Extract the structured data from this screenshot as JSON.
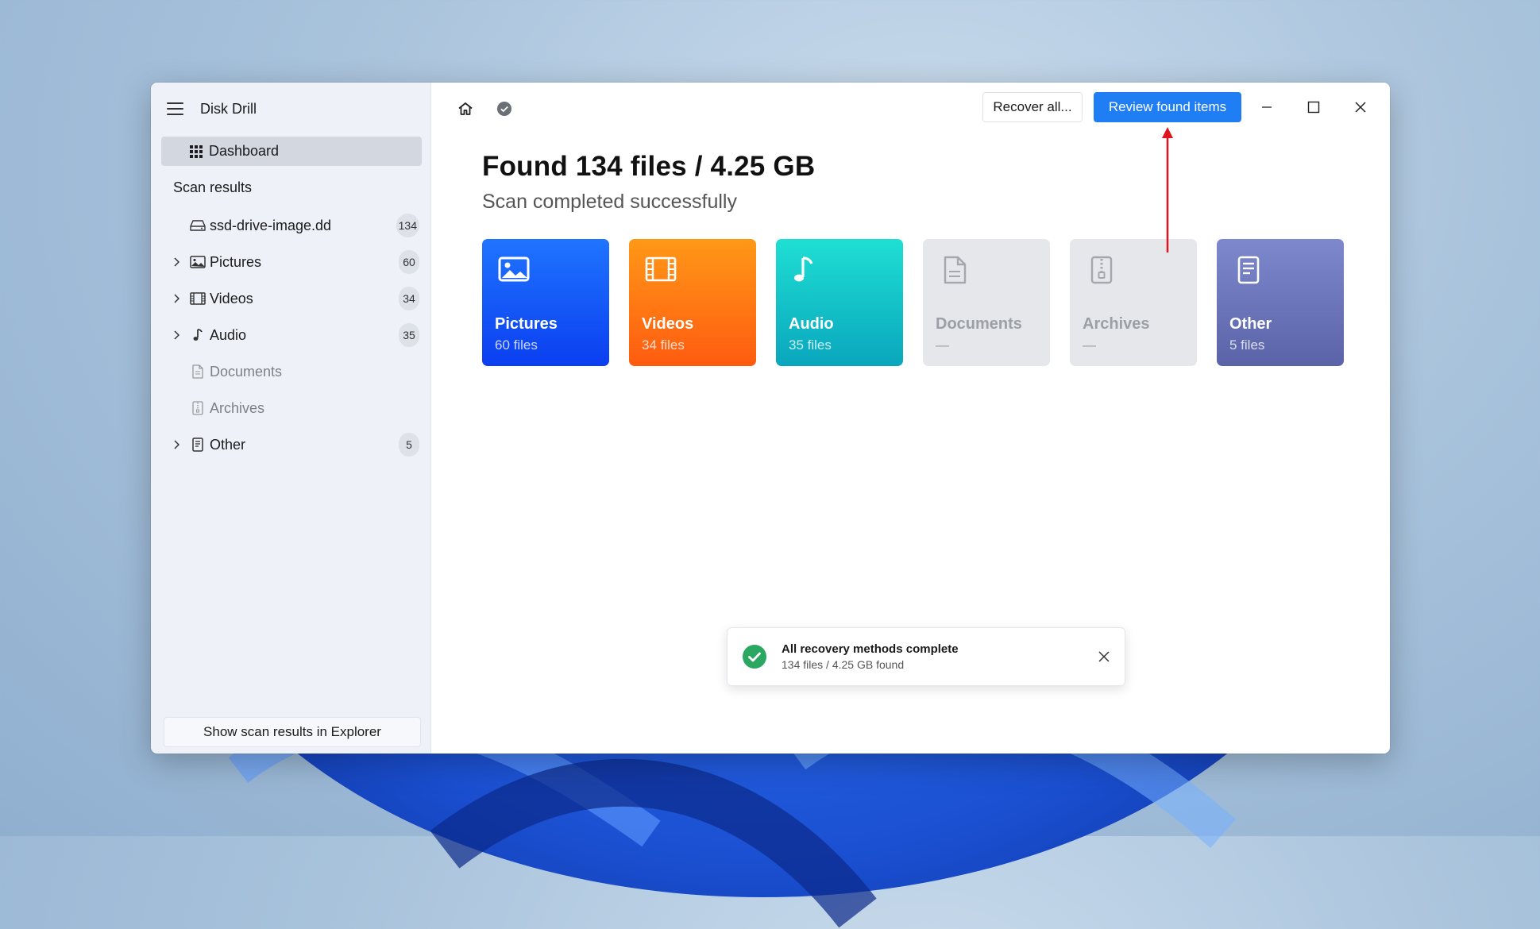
{
  "app": {
    "title": "Disk Drill"
  },
  "sidebar": {
    "dashboard_label": "Dashboard",
    "section_title": "Scan results",
    "items": [
      {
        "label": "ssd-drive-image.dd",
        "count": "134",
        "icon": "drive-icon",
        "expandable": false,
        "enabled": true
      },
      {
        "label": "Pictures",
        "count": "60",
        "icon": "picture-icon",
        "expandable": true,
        "enabled": true
      },
      {
        "label": "Videos",
        "count": "34",
        "icon": "film-icon",
        "expandable": true,
        "enabled": true
      },
      {
        "label": "Audio",
        "count": "35",
        "icon": "music-note-icon",
        "expandable": true,
        "enabled": true
      },
      {
        "label": "Documents",
        "count": "",
        "icon": "document-icon",
        "expandable": false,
        "enabled": false
      },
      {
        "label": "Archives",
        "count": "",
        "icon": "archive-icon",
        "expandable": false,
        "enabled": false
      },
      {
        "label": "Other",
        "count": "5",
        "icon": "other-file-icon",
        "expandable": true,
        "enabled": true
      }
    ],
    "footer_button": "Show scan results in Explorer"
  },
  "toolbar": {
    "recover_all": "Recover all...",
    "review_found": "Review found items"
  },
  "main": {
    "headline": "Found 134 files / 4.25 GB",
    "status": "Scan completed successfully",
    "tiles": [
      {
        "name": "Pictures",
        "count": "60 files",
        "color": "#1f62ff",
        "enabled": true
      },
      {
        "name": "Videos",
        "count": "34 files",
        "color": "#ff7a1a",
        "enabled": true
      },
      {
        "name": "Audio",
        "count": "35 files",
        "color": "#14c4c4",
        "enabled": true
      },
      {
        "name": "Documents",
        "count": "—",
        "color": "#e6e7ea",
        "enabled": false
      },
      {
        "name": "Archives",
        "count": "—",
        "color": "#e6e7ea",
        "enabled": false
      },
      {
        "name": "Other",
        "count": "5 files",
        "color": "#6b76bd",
        "enabled": true
      }
    ]
  },
  "toast": {
    "title": "All recovery methods complete",
    "subtitle": "134 files / 4.25 GB found"
  },
  "colors": {
    "accent": "#1f7ef4",
    "annotation_arrow": "#e0141e",
    "success": "#2aa760"
  }
}
